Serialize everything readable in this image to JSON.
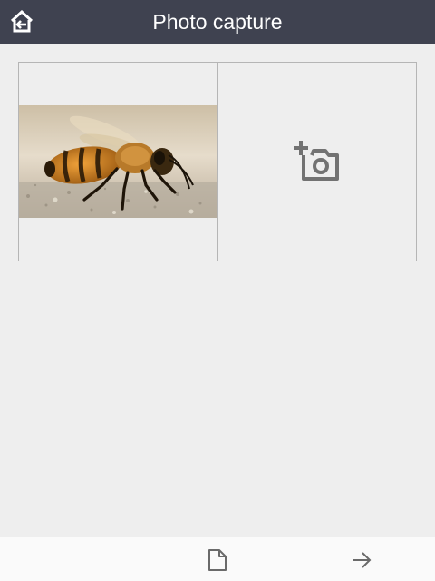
{
  "header": {
    "title": "Photo capture",
    "home_icon": "home-exit-icon",
    "background_color": "#3f4250"
  },
  "gallery": {
    "slots": [
      {
        "type": "photo",
        "subject": "bee"
      },
      {
        "type": "add",
        "icon": "add-photo-icon"
      }
    ]
  },
  "footer": {
    "buttons": [
      {
        "icon": "document-icon"
      },
      {
        "icon": "arrow-right-icon"
      }
    ]
  }
}
